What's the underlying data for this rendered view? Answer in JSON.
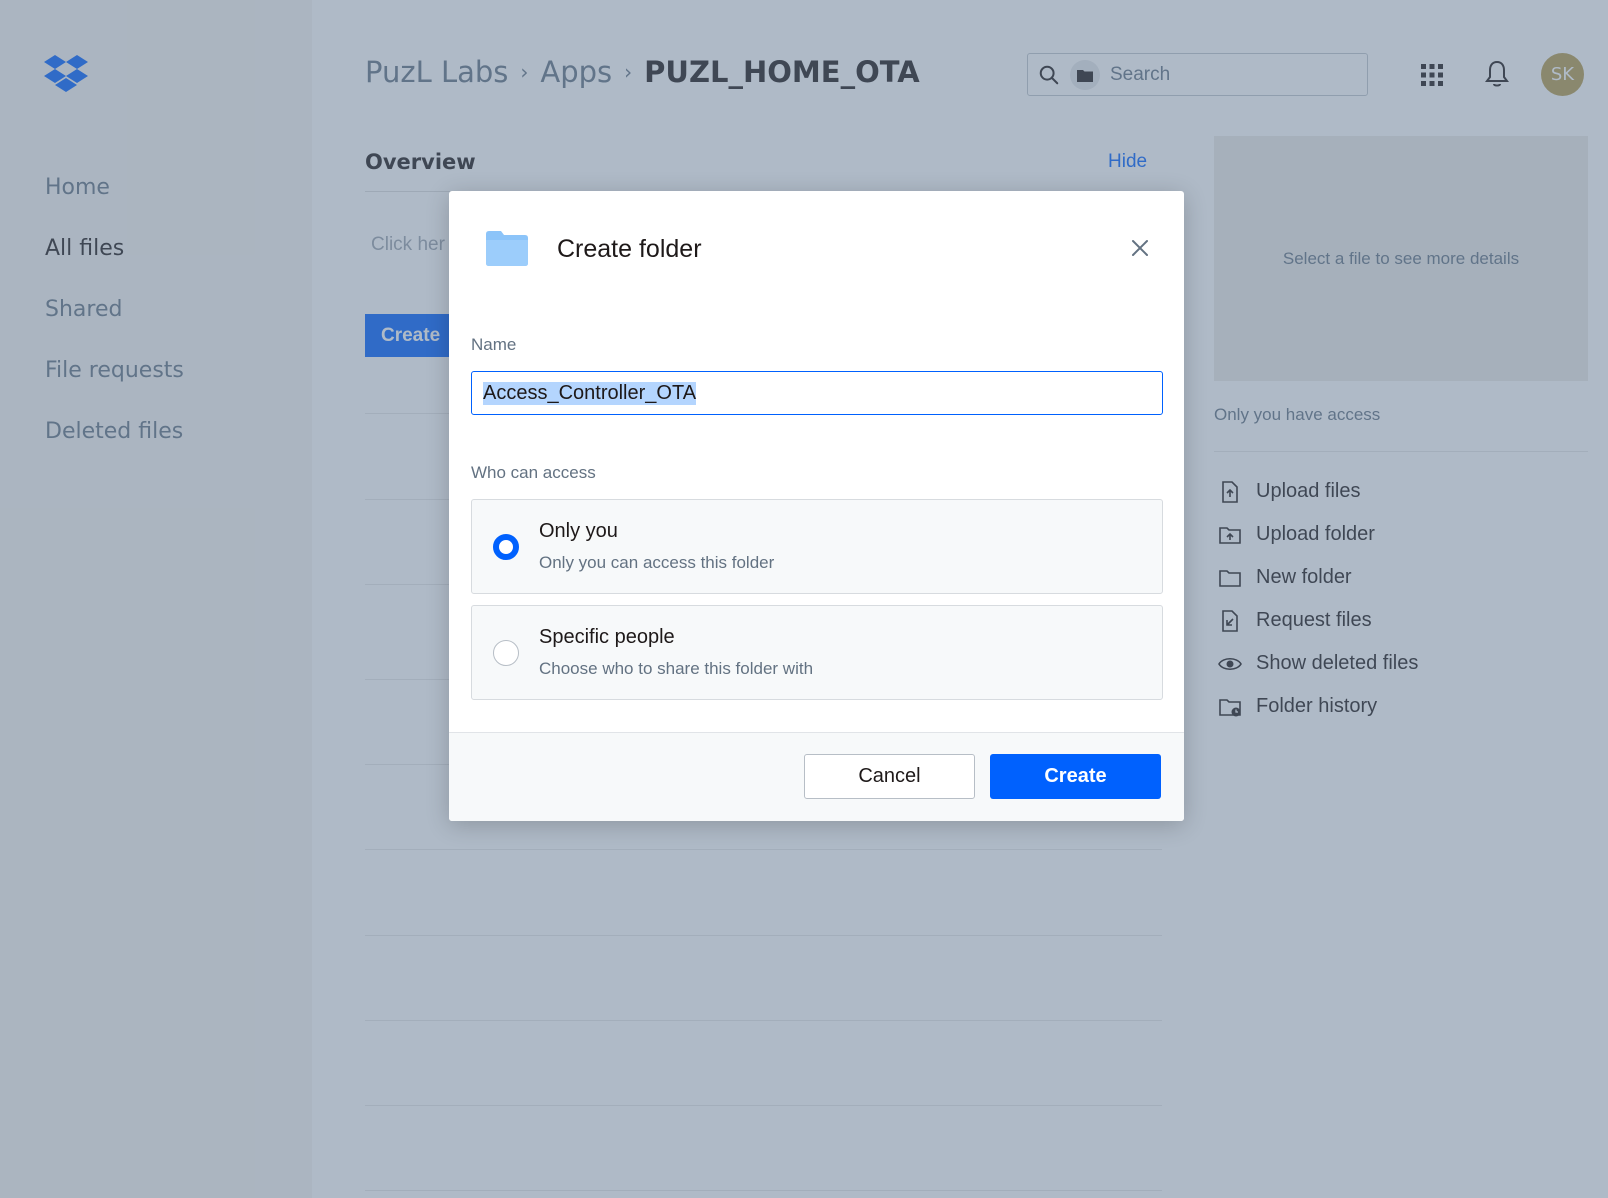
{
  "colors": {
    "accent": "#0061fe",
    "avatar": "#b59a4c",
    "folder": "#8cc4f9"
  },
  "sidebar": {
    "logo": "dropbox-logo",
    "items": [
      {
        "label": "Home",
        "active": false
      },
      {
        "label": "All files",
        "active": true
      },
      {
        "label": "Shared",
        "active": false
      },
      {
        "label": "File requests",
        "active": false
      },
      {
        "label": "Deleted files",
        "active": false
      }
    ]
  },
  "header": {
    "breadcrumb": [
      "PuzL Labs",
      "Apps",
      "PUZL_HOME_OTA"
    ],
    "search_placeholder": "Search",
    "avatar_initials": "SK"
  },
  "main": {
    "overview_title": "Overview",
    "hide_label": "Hide",
    "click_here": "Click her",
    "create_label": "Create"
  },
  "details": {
    "empty_message": "Select a file to see more details",
    "access": "Only you have access",
    "actions": [
      {
        "label": "Upload files",
        "icon": "upload-file-icon"
      },
      {
        "label": "Upload folder",
        "icon": "upload-folder-icon"
      },
      {
        "label": "New folder",
        "icon": "folder-icon"
      },
      {
        "label": "Request files",
        "icon": "request-files-icon"
      },
      {
        "label": "Show deleted files",
        "icon": "eye-icon"
      },
      {
        "label": "Folder history",
        "icon": "folder-history-icon"
      }
    ]
  },
  "modal": {
    "title": "Create folder",
    "name_label": "Name",
    "name_value": "Access_Controller_OTA",
    "access_label": "Who can access",
    "options": [
      {
        "title": "Only you",
        "subtitle": "Only you can access this folder",
        "selected": true
      },
      {
        "title": "Specific people",
        "subtitle": "Choose who to share this folder with",
        "selected": false
      }
    ],
    "cancel_label": "Cancel",
    "create_label": "Create"
  }
}
